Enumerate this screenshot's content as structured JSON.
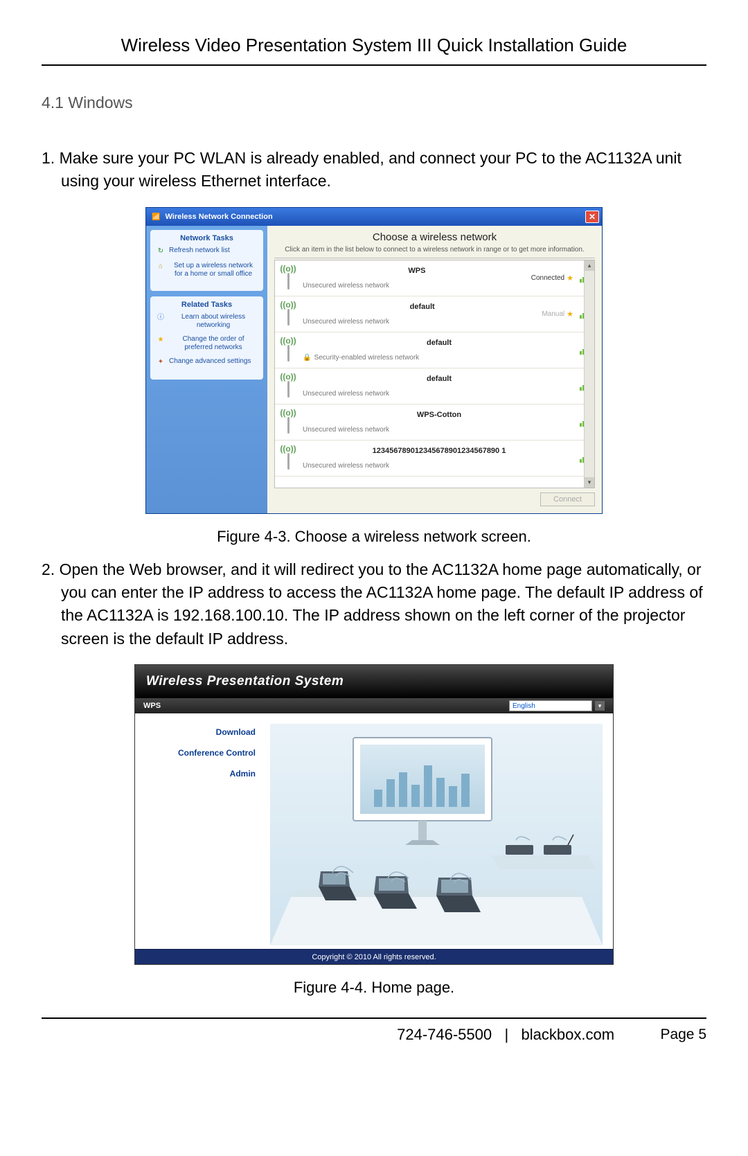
{
  "header": {
    "title": "Wireless Video Presentation System III Quick Installation Guide"
  },
  "section": {
    "heading": "4.1 Windows"
  },
  "steps": {
    "s1": "1. Make sure your PC WLAN is already enabled, and connect your PC to the AC1132A unit using your wireless Ethernet interface.",
    "s2": "2. Open the Web browser, and it will redirect you to the AC1132A home page automatically, or you can enter the IP address to access the AC1132A home page. The default IP address of the AC1132A is 192.168.100.10. The IP address shown on the left corner of the projector screen is the default IP address."
  },
  "fig43": {
    "caption": "Figure 4-3. Choose a wireless network screen.",
    "window_title": "Wireless Network Connection",
    "main_title": "Choose a wireless network",
    "main_sub": "Click an item in the list below to connect to a wireless network in range or to get more information.",
    "side": {
      "panel1_title": "Network Tasks",
      "panel1_items": [
        "Refresh network list",
        "Set up a wireless network for a home or small office"
      ],
      "panel2_title": "Related Tasks",
      "panel2_items": [
        "Learn about wireless networking",
        "Change the order of preferred networks",
        "Change advanced settings"
      ]
    },
    "networks": [
      {
        "ssid": "WPS",
        "desc": "Unsecured wireless network",
        "status": "Connected",
        "secure": false,
        "signal": "strong"
      },
      {
        "ssid": "default",
        "desc": "Unsecured wireless network",
        "status": "Manual",
        "secure": false,
        "signal": "strong"
      },
      {
        "ssid": "default",
        "desc": "Security-enabled wireless network",
        "status": "",
        "secure": true,
        "signal": "strong"
      },
      {
        "ssid": "default",
        "desc": "Unsecured wireless network",
        "status": "",
        "secure": false,
        "signal": "strong"
      },
      {
        "ssid": "WPS-Cotton",
        "desc": "Unsecured wireless network",
        "status": "",
        "secure": false,
        "signal": "weak"
      },
      {
        "ssid": "123456789012345678901234567890 1",
        "desc": "Unsecured wireless network",
        "status": "",
        "secure": false,
        "signal": "strong"
      }
    ],
    "connect_label": "Connect"
  },
  "fig44": {
    "caption": "Figure 4-4. Home page.",
    "header_title": "Wireless Presentation System",
    "bar_left": "WPS",
    "lang": "English",
    "nav": [
      "Download",
      "Conference Control",
      "Admin"
    ],
    "footer": "Copyright © 2010 All rights reserved."
  },
  "footer": {
    "phone": "724-746-5500",
    "divider": "|",
    "site": "blackbox.com",
    "page": "Page 5"
  }
}
